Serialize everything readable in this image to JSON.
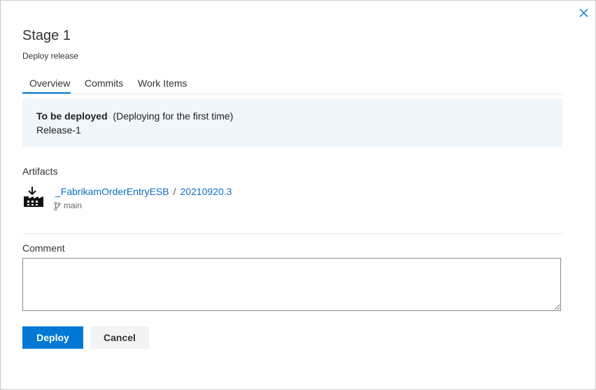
{
  "dialog": {
    "title": "Stage 1",
    "subtitle": "Deploy release",
    "close_icon": "close-icon"
  },
  "tabs": [
    {
      "label": "Overview",
      "active": true
    },
    {
      "label": "Commits",
      "active": false
    },
    {
      "label": "Work Items",
      "active": false
    }
  ],
  "banner": {
    "heading": "To be deployed",
    "note": "(Deploying for the first time)",
    "release": "Release-1"
  },
  "artifacts": {
    "label": "Artifacts",
    "icon": "build-artifact-icon",
    "name": "_FabrikamOrderEntryESB",
    "separator": "/",
    "version": "20210920.3",
    "branch_icon": "branch-icon",
    "branch": "main"
  },
  "comment": {
    "label": "Comment",
    "value": "",
    "placeholder": ""
  },
  "actions": {
    "deploy_label": "Deploy",
    "cancel_label": "Cancel"
  },
  "colors": {
    "accent": "#0078d4",
    "banner_bg": "#eff6fc",
    "link": "#106ebe"
  }
}
